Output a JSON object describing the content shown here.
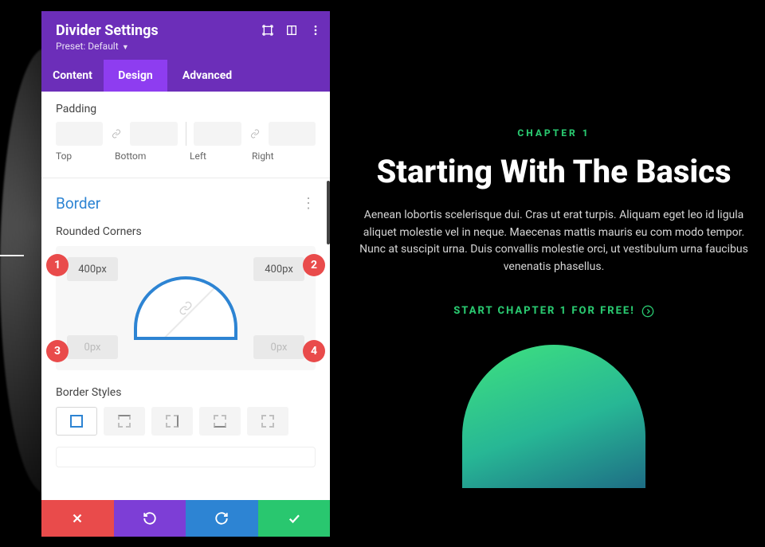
{
  "panel": {
    "title": "Divider Settings",
    "preset_label": "Preset: Default",
    "tabs": [
      "Content",
      "Design",
      "Advanced"
    ],
    "active_tab": 1,
    "padding": {
      "label": "Padding",
      "cols": [
        "Top",
        "Bottom",
        "Left",
        "Right"
      ]
    },
    "border": {
      "section_label": "Border",
      "rounded_label": "Rounded Corners",
      "tl": "400px",
      "tr": "400px",
      "bl": "0px",
      "br": "0px",
      "styles_label": "Border Styles"
    },
    "badges": [
      "1",
      "2",
      "3",
      "4"
    ]
  },
  "preview": {
    "chapter": "CHAPTER 1",
    "heading": "Starting With The Basics",
    "desc": "Aenean lobortis scelerisque dui. Cras ut erat turpis. Aliquam eget leo id ligula aliquet molestie vel in neque. Maecenas mattis mauris eu com modo tempor. Nunc at suscipit urna. Duis convallis molestie orci, ut vestibulum urna faucibus venenatis phasellus.",
    "cta": "START CHAPTER 1 FOR FREE!"
  },
  "colors": {
    "accent_purple": "#6c2eb9",
    "accent_green": "#29c76f",
    "accent_blue": "#2d84d3",
    "accent_red": "#e94b4b"
  }
}
